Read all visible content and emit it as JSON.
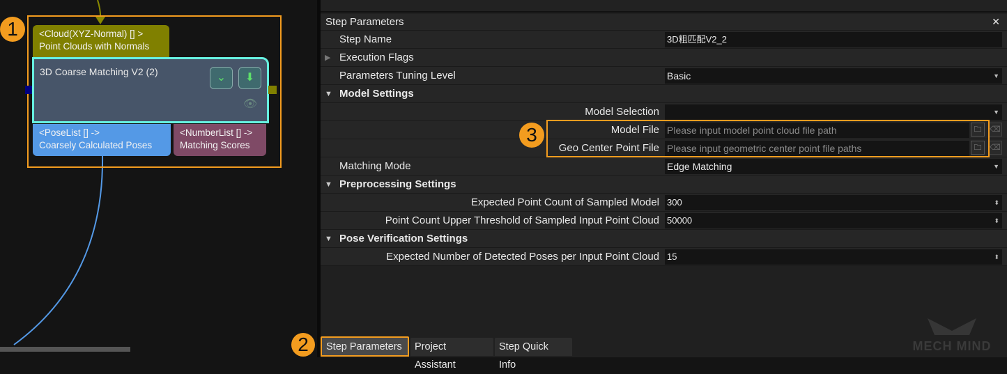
{
  "graph": {
    "badge1": "1",
    "input_port": {
      "type": "<Cloud(XYZ-Normal) [] >",
      "name": "Point Clouds with Normals"
    },
    "step": {
      "title": "3D Coarse Matching V2 (2)"
    },
    "output_ports": [
      {
        "type": "<PoseList [] ->",
        "name": "Coarsely Calculated Poses"
      },
      {
        "type": "<NumberList [] ->",
        "name": "Matching Scores"
      }
    ],
    "colors": {
      "input": "#808000",
      "step": "#475569",
      "step_border": "#66f0e0",
      "pose": "#5499e6",
      "number": "#7f4a66",
      "highlight": "#f39c1f"
    }
  },
  "panel": {
    "title": "Step Parameters",
    "close": "✕",
    "badge3": "3",
    "rows": [
      {
        "label": "Step Name",
        "value": "3D粗匹配V2_2"
      },
      {
        "label": "Execution Flags"
      },
      {
        "label": "Parameters Tuning Level",
        "value": "Basic"
      },
      {
        "label": "Model Settings"
      },
      {
        "label": "Model Selection",
        "value": ""
      },
      {
        "label": "Model File",
        "placeholder": "Please input model point cloud file path"
      },
      {
        "label": "Geo Center Point File",
        "placeholder": "Please input geometric center point file paths"
      },
      {
        "label": "Matching Mode",
        "value": "Edge Matching"
      },
      {
        "label": "Preprocessing Settings"
      },
      {
        "label": "Expected Point Count of Sampled Model",
        "value": "300"
      },
      {
        "label": "Point Count Upper Threshold of Sampled Input Point Cloud",
        "value": "50000"
      },
      {
        "label": "Pose Verification Settings"
      },
      {
        "label": "Expected Number of Detected Poses per Input Point Cloud",
        "value": "15"
      }
    ]
  },
  "tabs": {
    "badge2": "2",
    "items": [
      "Step Parameters",
      "Project Assistant",
      "Step Quick Info"
    ],
    "active": 0
  },
  "watermark": "MECH MIND"
}
